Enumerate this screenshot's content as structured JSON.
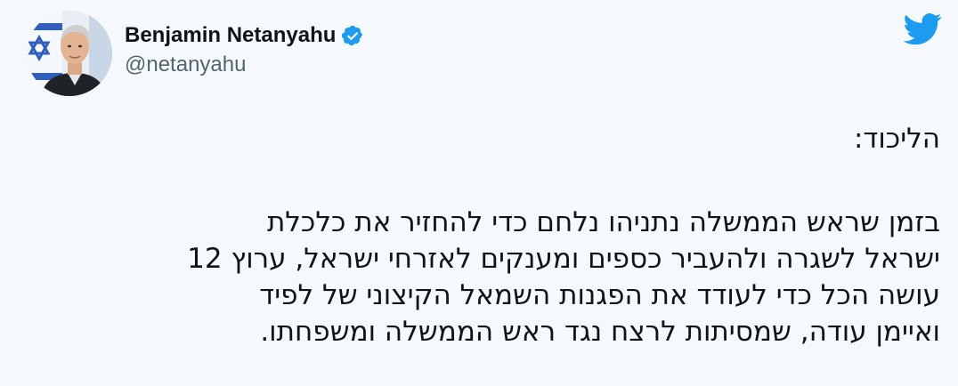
{
  "author": {
    "display_name": "Benjamin Netanyahu",
    "handle": "@netanyahu",
    "verified": true,
    "avatar_icon": "profile-photo"
  },
  "brand": {
    "icon": "twitter-bird-icon",
    "color": "#1d9bf0"
  },
  "tweet": {
    "label": "הליכוד:",
    "lines": [
      "בזמן שראש הממשלה נתניהו נלחם כדי להחזיר את כלכלת",
      "ישראל לשגרה ולהעביר כספים ומענקים לאזרחי ישראל, ערוץ 12",
      " עושה הכל כדי לעודד את הפגנות השמאל הקיצוני של לפיד",
      "ואיימן עודה, שמסיתות לרצח נגד ראש הממשלה ומשפחתו."
    ]
  }
}
